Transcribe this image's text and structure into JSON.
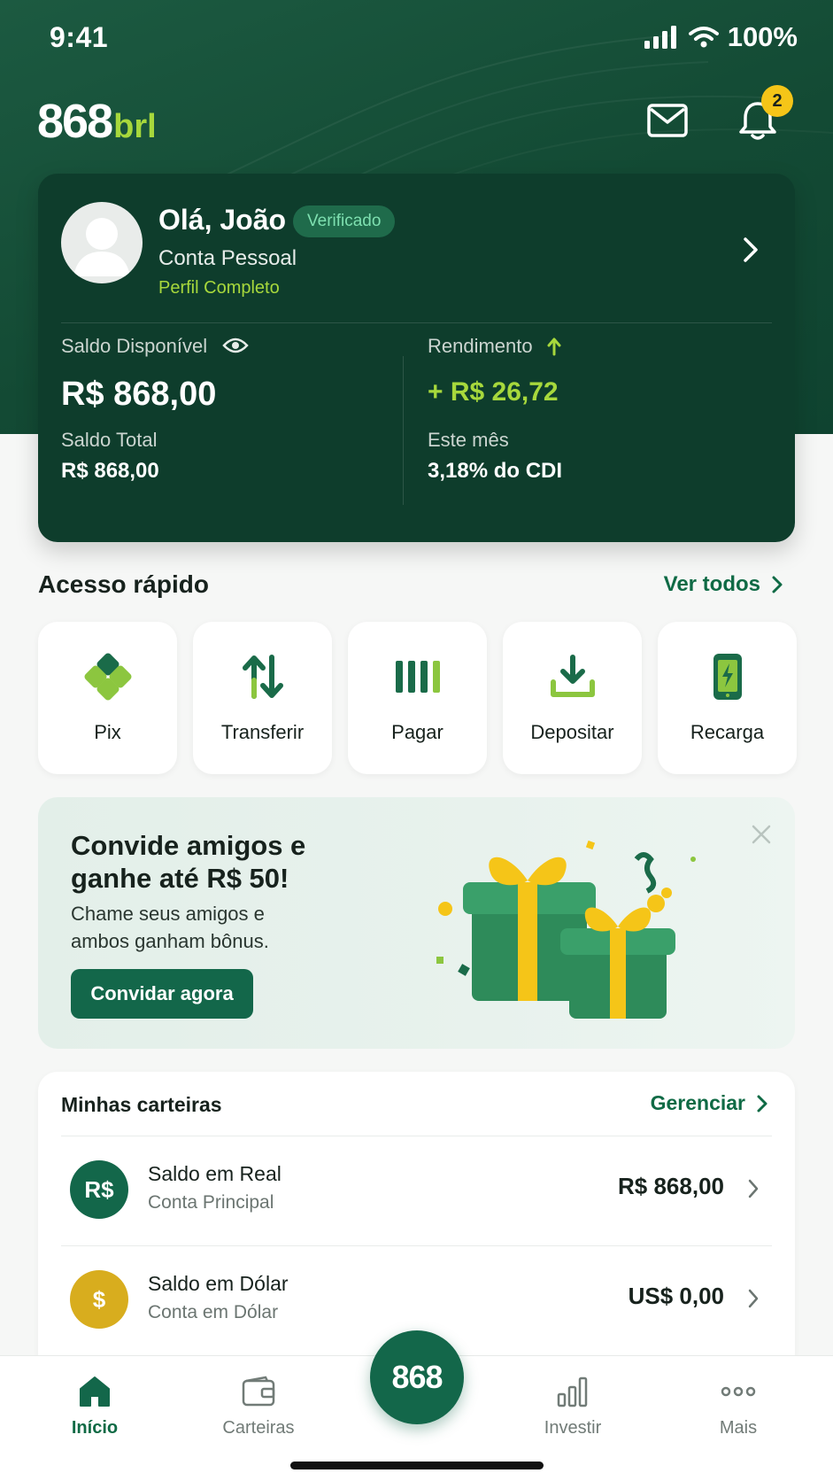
{
  "status": {
    "time": "9:41",
    "battery": "100%"
  },
  "brand": {
    "number": "868",
    "suffix": "brl"
  },
  "header": {
    "notification_count": "2"
  },
  "profile": {
    "greeting": "Olá, João",
    "verified_badge": "Verificado",
    "account_type": "Conta Pessoal",
    "profile_status": "Perfil Completo"
  },
  "balance": {
    "available_label": "Saldo Disponível",
    "available_value": "R$ 868,00",
    "total_label": "Saldo Total",
    "total_value": "R$ 868,00",
    "yield_label": "Rendimento",
    "yield_value": "+ R$ 26,72",
    "period_label": "Este mês",
    "cdi_value": "3,18% do CDI"
  },
  "quick_access": {
    "title": "Acesso rápido",
    "see_all": "Ver todos",
    "items": [
      {
        "label": "Pix",
        "icon": "pix-icon"
      },
      {
        "label": "Transferir",
        "icon": "transfer-arrows-icon"
      },
      {
        "label": "Pagar",
        "icon": "barcode-icon"
      },
      {
        "label": "Depositar",
        "icon": "download-tray-icon"
      },
      {
        "label": "Recarga",
        "icon": "phone-charge-icon"
      }
    ]
  },
  "promo": {
    "title": "Convide amigos e ganhe até R$ 50!",
    "subtitle": "Chame seus amigos e ambos ganham bônus.",
    "cta": "Convidar agora"
  },
  "wallets": {
    "title": "Minhas carteiras",
    "manage": "Gerenciar",
    "items": [
      {
        "icon_text": "R$",
        "name": "Saldo em Real",
        "sub": "Conta Principal",
        "amount": "R$ 868,00"
      },
      {
        "icon_text": "$",
        "name": "Saldo em Dólar",
        "sub": "Conta em Dólar",
        "amount": "US$ 0,00"
      }
    ]
  },
  "tabbar": {
    "items": [
      {
        "label": "Início",
        "icon": "home-icon",
        "active": true
      },
      {
        "label": "Carteiras",
        "icon": "wallet-icon"
      },
      {
        "label": "Investir",
        "icon": "bar-chart-icon"
      },
      {
        "label": "Mais",
        "icon": "more-dots-icon"
      }
    ],
    "center_label": "868"
  },
  "colors": {
    "primary": "#13674a",
    "dark": "#0e3d2c",
    "accent": "#a7d83c",
    "gold": "#f5c518"
  }
}
